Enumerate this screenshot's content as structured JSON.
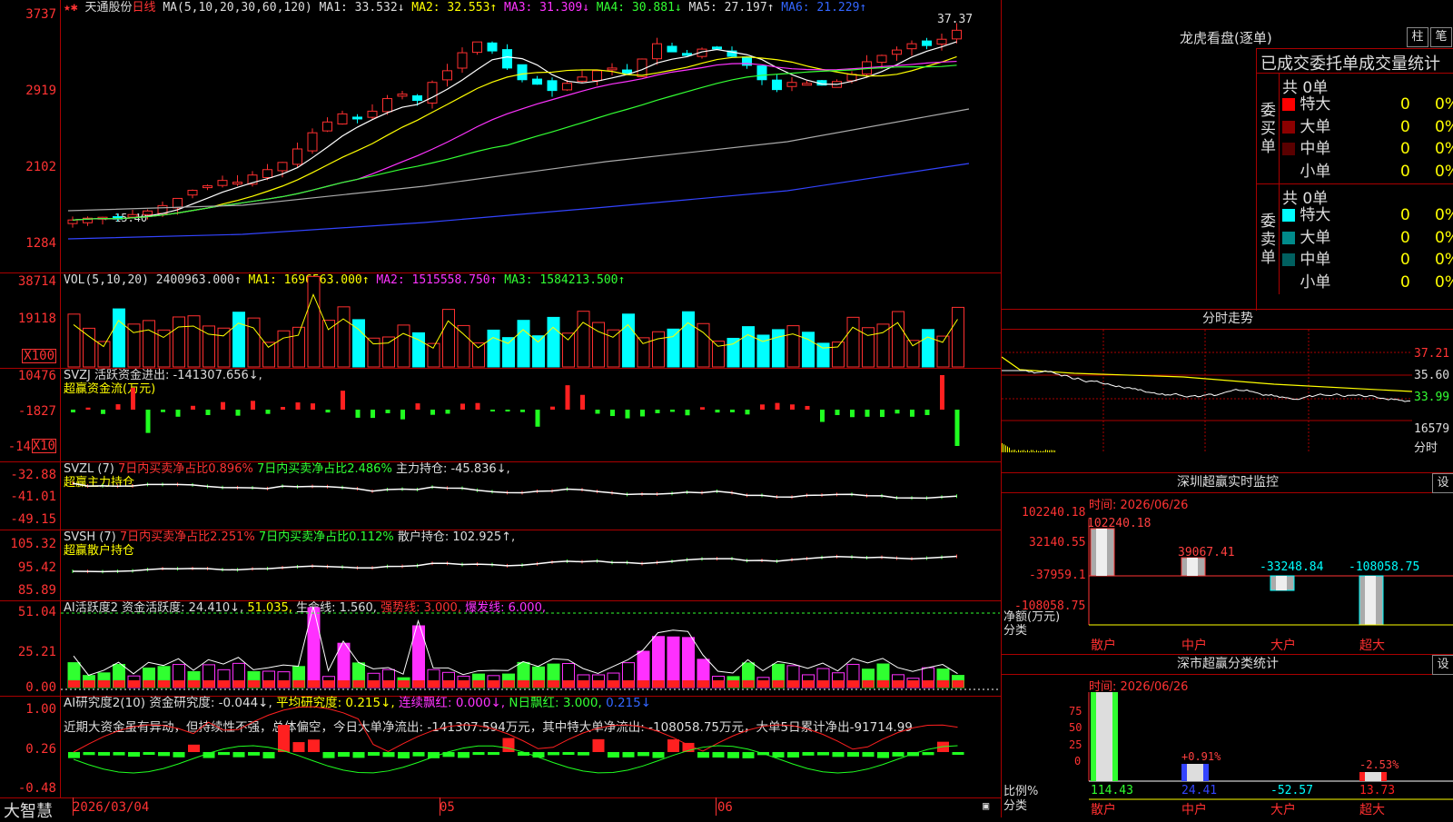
{
  "stock": {
    "name": "天通股份",
    "period": "日线"
  },
  "ma_header": {
    "label": "MA(5,10,20,30,60,120)",
    "ma1": "MA1: 33.532↓",
    "ma2": "MA2: 32.553↑",
    "ma3": "MA3: 31.309↓",
    "ma4": "MA4: 30.881↓",
    "ma5": "MA5: 27.197↑",
    "ma6": "MA6: 21.229↑"
  },
  "price_axis": [
    "3737",
    "2919",
    "2102",
    "1284"
  ],
  "price_marks": {
    "high": "37.37",
    "low": "15.40"
  },
  "vol_header": {
    "label": "VOL(5,10,20)",
    "value": "2400963.000↑",
    "ma1": "MA1: 1696563.000↑",
    "ma2": "MA2: 1515558.750↑",
    "ma3": "MA3: 1584213.500↑"
  },
  "vol_axis": [
    "38714",
    "19118",
    "X100"
  ],
  "svzj_header": {
    "label": "SVZJ  活跃资金进出: -141307.656↓,",
    "sub": "超赢资金流(万元)"
  },
  "svzj_axis": [
    "10476",
    "-1827",
    "-14",
    "X10"
  ],
  "svzl_header": {
    "label": "SVZL (7)",
    "a": "7日内买卖净占比0.896%",
    "b": "7日内买卖净占比2.486%",
    "c": "主力持仓: -45.836↓,",
    "sub": "超赢主力持仓"
  },
  "svzl_axis": [
    "-32.88",
    "-41.01",
    "-49.15"
  ],
  "svsh_header": {
    "label": "SVSH (7)",
    "a": "7日内买卖净占比2.251%",
    "b": "7日内买卖净占比0.112%",
    "c": "散户持仓: 102.925↑,",
    "sub": "超赢散户持仓"
  },
  "svsh_axis": [
    "105.32",
    "95.42",
    "85.89"
  ],
  "ai_header": {
    "label": "AI活跃度2",
    "a": "资金活跃度: 24.410↓,",
    "b": "51.035,",
    "c": "生命线: 1.560,",
    "d": "强势线: 3.000,",
    "e": "爆发线: 6.000,"
  },
  "ai_axis": [
    "51.04",
    "25.21",
    "0.00"
  ],
  "air_header": {
    "label": "AI研究度2(10)",
    "a": "资金研究度: -0.044↓,",
    "b": "平均研究度: 0.215↓,",
    "c": "连续飘红: 0.000↓,",
    "d": "N日飘红: 3.000,",
    "e": "0.215↓"
  },
  "air_axis": [
    "1.00",
    "0.26",
    "-0.48"
  ],
  "air_comment": "近期大资金虽有异动，但持续性不强，总体偏空，今日大单净流出: -141307.594万元，其中特大单净流出: -108058.75万元，大单5日累计净出-91714.99",
  "bottom": {
    "brand": "大智慧",
    "date": "2026/03/04",
    "m5": "05",
    "m6": "06"
  },
  "lhb": {
    "title": "龙虎看盘(逐单)",
    "btn1": "柱",
    "btn2": "笔",
    "subtitle": "已成交委托单成交量统计",
    "buy": {
      "side": "委买单",
      "total": "共 0单",
      "rows": [
        {
          "name": "特大",
          "color": "#ff0000",
          "qty": "0",
          "pct": "0%"
        },
        {
          "name": "大单",
          "color": "#8b0000",
          "qty": "0",
          "pct": "0%"
        },
        {
          "name": "中单",
          "color": "#5a0000",
          "qty": "0",
          "pct": "0%"
        },
        {
          "name": "小单",
          "color": "#000000",
          "qty": "0",
          "pct": "0%"
        }
      ]
    },
    "sell": {
      "side": "委卖单",
      "total": "共 0单",
      "rows": [
        {
          "name": "特大",
          "color": "#00ffff",
          "qty": "0",
          "pct": "0%"
        },
        {
          "name": "大单",
          "color": "#008b8b",
          "qty": "0",
          "pct": "0%"
        },
        {
          "name": "中单",
          "color": "#006060",
          "qty": "0",
          "pct": "0%"
        },
        {
          "name": "小单",
          "color": "#000000",
          "qty": "0",
          "pct": "0%"
        }
      ]
    }
  },
  "intraday": {
    "title": "分时走势",
    "axis": [
      "37.21",
      "35.60",
      "33.99",
      "16579",
      "分时"
    ]
  },
  "monitor": {
    "title": "深圳超赢实时监控",
    "btn": "设",
    "time": "时间: 2026/06/26",
    "axis": [
      "102240.18",
      "32140.55",
      "-37959.1",
      "-108058.75"
    ],
    "ylabel1": "净额(万元)",
    "ylabel2": "分类",
    "bars": [
      {
        "name": "散户",
        "value": "102240.18"
      },
      {
        "name": "中户",
        "value": "39067.41"
      },
      {
        "name": "大户",
        "value": "-33248.84"
      },
      {
        "name": "超大",
        "value": "-108058.75"
      }
    ]
  },
  "classify": {
    "title": "深市超赢分类统计",
    "btn": "设",
    "time": "时间: 2026/06/26",
    "axis": [
      "75",
      "50",
      "25",
      "0"
    ],
    "ylabel1": "比例%",
    "ylabel2": "分类",
    "bars": [
      {
        "name": "散户",
        "value": "114.43",
        "label": ""
      },
      {
        "name": "中户",
        "value": "24.41",
        "label": "+0.91%"
      },
      {
        "name": "大户",
        "value": "-52.57",
        "label": ""
      },
      {
        "name": "超大",
        "value": "13.73",
        "label": "-2.53%"
      }
    ]
  }
}
